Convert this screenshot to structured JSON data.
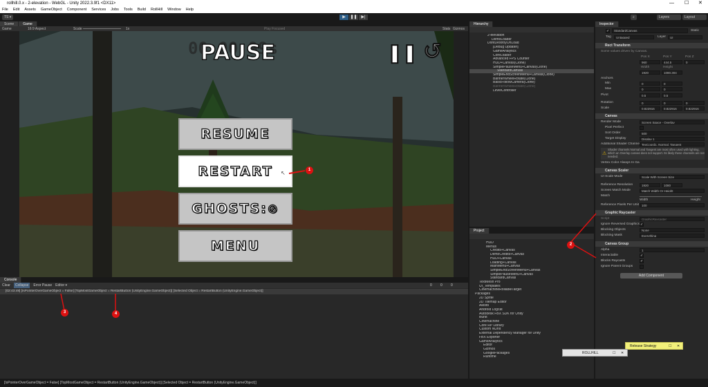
{
  "window": {
    "title": "rollhill.0.x - 2-elevation - WebGL - Unity 2022.3.9f1 <DX11>",
    "minimize": "—",
    "maximize": "☐",
    "close": "✕"
  },
  "menu": [
    "File",
    "Edit",
    "Assets",
    "GameObject",
    "Component",
    "Services",
    "Jobs",
    "Tools",
    "Build",
    "RollHill",
    "Window",
    "Help"
  ],
  "toolbar": {
    "account": "TS ▾",
    "layers": "Layers",
    "layout": "Layout"
  },
  "tabs": {
    "scene": "Scene",
    "game": "Game",
    "hierarchy": "Hierarchy",
    "inspector": "Inspector",
    "project": "Project",
    "console": "Console"
  },
  "gamebar": {
    "display": "Game",
    "aspect": "16:9 Aspect",
    "scale_label": "Scale",
    "scale_value": "1x",
    "play_focused": "Play Focused",
    "stats": "Stats",
    "gizmos": "Gizmos"
  },
  "game": {
    "title": "PAUSE",
    "timer": "00:00.99s",
    "buttons": [
      "RESUME",
      "RESTART",
      "GHOSTS: ",
      "MENU"
    ]
  },
  "console": {
    "clear": "Clear",
    "collapse": "Collapse",
    "error_pause": "Error Pause",
    "editor": "Editor ▾",
    "log": "[02:43:49] [IsPointerOverGameObject = False] [TopMostGameObject = RestartButton (UnityEngine.GameObject)] [Selected Object = RestartButton (UnityEngine.GameObject)]",
    "counts": [
      "0",
      "0",
      "0"
    ]
  },
  "status": "[IsPointerOverGameObject = False] [TopMostGameObject = RestartButton (UnityEngine.GameObject)] [Selected Object = RestartButton (UnityEngine.GameObject)]",
  "hierarchy": [
    "2-elevation",
    "DemoLoader",
    "DontDestroyOnLoad",
    "[Debug Updater]",
    "GameAnalytics",
    "CoreLoader",
    "Advanced FPS Counter",
    "HUD+Canvas(Clone)",
    "SimplePauseMenu+Canvas(Clone)",
    "StandardCanvas",
    "SimpleEndScreenMenu+Canvas(Clone)",
    "BannerWheelRotate(Clone)",
    "BasicFollowCamera(Clone)",
    "BannerWheelRotate(Clone)",
    "LevelController"
  ],
  "project": [
    "HUD",
    "Menus",
    "Credits+Canvas",
    "DemoCredits+Canvas",
    "HUD+Canvas",
    "Loading+Canvas",
    "MainMenu+Canvas",
    "SimpleEndScreenMenu+Canvas",
    "SimplePauseMenu+Canvas",
    "StandardCanvas",
    "TextMesh Pro",
    "UI_Templates",
    "CinemachineRollableTarget",
    "Packages",
    "2D Sprite",
    "2D Tilemap Editor",
    "Aleotti",
    "Android Logcat",
    "Autodesk FBX SDK for Unity",
    "Burst",
    "Cinemachine",
    "Core RP Library",
    "Custom NUnit",
    "External Dependency Manager for Unity",
    "FBX Exporter",
    "GameAnalytics",
    "Editor",
    "Gizmos",
    "GooglePackages",
    "Runtime"
  ],
  "inspector": {
    "name": "StandardCanvas",
    "static": "Static",
    "tag_label": "Tag",
    "tag": "Untagged",
    "layer_label": "Layer",
    "layer": "UI",
    "rect_transform": "Rect Transform",
    "rect_note": "Some values driven by Canvas.",
    "pos_labels": [
      "Pos X",
      "Pos Y",
      "Pos Z"
    ],
    "pos": [
      "960",
      "444.5",
      "0"
    ],
    "size_labels": [
      "Width",
      "Height"
    ],
    "size": [
      "1920",
      "1080.304"
    ],
    "anchors": "Anchors",
    "min": "Min",
    "max": "Max",
    "min_vals": [
      "0",
      "0"
    ],
    "max_vals": [
      "0",
      "0"
    ],
    "pivot": "Pivot",
    "pivot_vals": [
      "0.5",
      "0.5"
    ],
    "rotation": "Rotation",
    "rot_vals": [
      "0",
      "0",
      "0"
    ],
    "scale": "Scale",
    "scale_vals": [
      "0.822916",
      "0.822916",
      "0.822916"
    ],
    "canvas": "Canvas",
    "render_mode_label": "Render Mode",
    "render_mode": "Screen Space - Overlay",
    "pixel_perfect": "Pixel Perfect",
    "sort_order_label": "Sort Order",
    "sort_order": "500",
    "target_display_label": "Target Display",
    "target_display": "Display 1",
    "shader_channels_label": "Additional Shader Channels",
    "shader_channels": "TexCoord1, Normal, Tangent",
    "warning": "Shader channels Normal and Tangent are most often used with lighting, which an Overlay canvas does not support. Its likely these channels are not needed.",
    "vertex_color": "Vertex Color Always In Ga",
    "scaler": "Canvas Scaler",
    "ui_scale_label": "UI Scale Mode",
    "ui_scale": "Scale With Screen Size",
    "ref_res_label": "Reference Resolution",
    "ref_x": "1920",
    "ref_y": "1080",
    "match_mode_label": "Screen Match Mode",
    "match_mode": "Match Width Or Height",
    "match_label": "Match",
    "match_width": "Width",
    "match_height": "Height",
    "ppu_label": "Reference Pixels Per Unit",
    "ppu": "100",
    "raycaster": "Graphic Raycaster",
    "script_label": "Script",
    "script": "GraphicRaycaster",
    "ignore_reversed": "Ignore Reversed Graphics",
    "blocking_objects_label": "Blocking Objects",
    "blocking_objects": "None",
    "blocking_mask_label": "Blocking Mask",
    "blocking_mask": "Everything",
    "group": "Canvas Group",
    "alpha_label": "Alpha",
    "alpha": "1",
    "interactable": "Interactable",
    "blocks": "Blocks Raycasts",
    "ignore_parent": "Ignore Parent Groups",
    "add_component": "Add Component"
  },
  "popups": {
    "release": "Release Strategy",
    "rollhill": "ROLLHILL"
  },
  "annotations": [
    "1",
    "2",
    "3",
    "4"
  ],
  "colors": {
    "accent": "#2c5d87",
    "annotation": "#dd1111",
    "popup_yellow": "#f2f07a"
  }
}
